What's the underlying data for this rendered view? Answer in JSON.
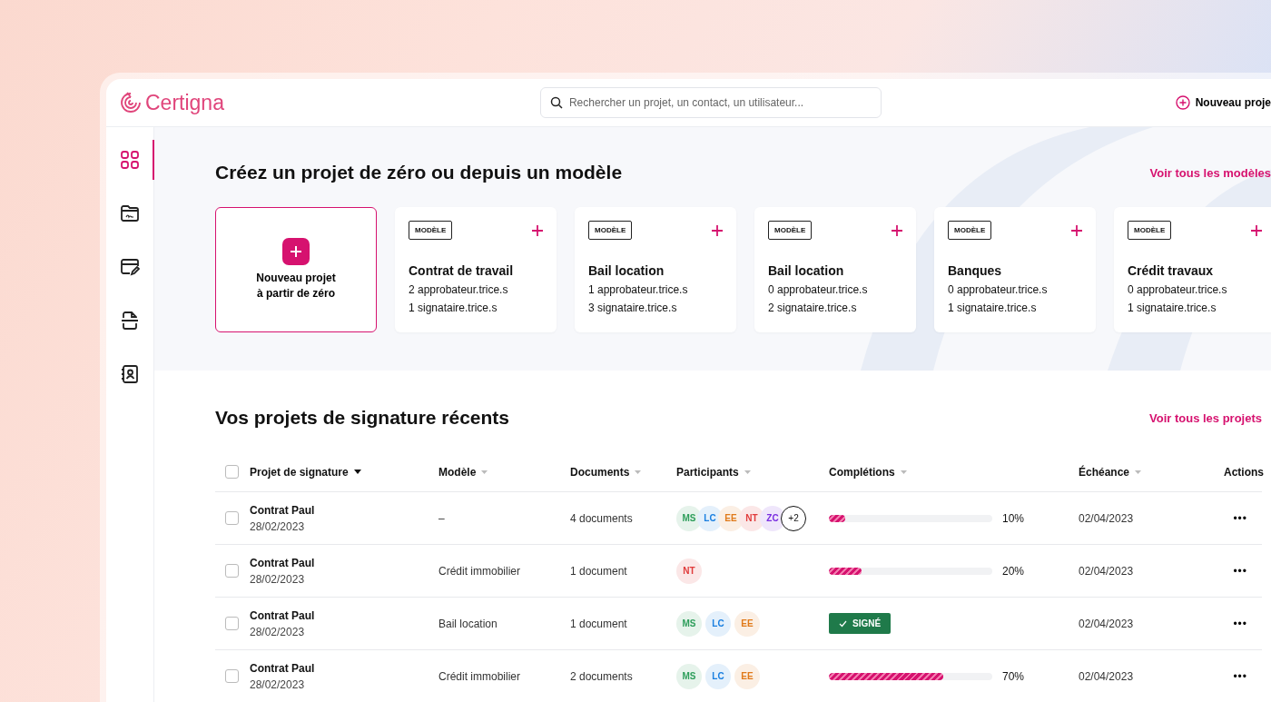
{
  "header": {
    "logo": "Certigna",
    "search": {
      "placeholder": "Rechercher un projet, un contact, un utilisateur..."
    },
    "new_project_button": "Nouveau proje"
  },
  "sidebar": {
    "items": [
      {
        "kind": "grid",
        "selected": true
      },
      {
        "kind": "folder",
        "selected": false
      },
      {
        "kind": "card",
        "selected": false
      },
      {
        "kind": "scan",
        "selected": false
      },
      {
        "kind": "contact",
        "selected": false
      }
    ]
  },
  "templates": {
    "title": "Créez un projet de zéro ou depuis un modèle",
    "link": "Voir tous les modèles",
    "new_card": {
      "label_1": "Nouveau projet",
      "label_2": "à partir de zéro"
    },
    "cards": [
      {
        "badge": "MODÈLE",
        "title": "Contrat de travail",
        "line_1": "2 approbateur.trice.s",
        "line_2": "1  signataire.trice.s"
      },
      {
        "badge": "MODÈLE",
        "title": "Bail location",
        "line_1": "1  approbateur.trice.s",
        "line_2": "3 signataire.trice.s"
      },
      {
        "badge": "MODÈLE",
        "title": "Bail location",
        "line_1": "0 approbateur.trice.s",
        "line_2": "2 signataire.trice.s"
      },
      {
        "badge": "MODÈLE",
        "title": "Banques",
        "line_1": "0 approbateur.trice.s",
        "line_2": "1  signataire.trice.s"
      },
      {
        "badge": "MODÈLE",
        "title": "Crédit travaux",
        "line_1": "0 approbateur.trice.s",
        "line_2": "1  signataire.trice.s"
      }
    ]
  },
  "recent": {
    "title": "Vos projets de signature récents",
    "link": "Voir tous les projets",
    "table": {
      "select_all_checked": false,
      "columns": [
        {
          "label": "Projet de signature",
          "sorted": true
        },
        {
          "label": "Modèle",
          "sorted": false
        },
        {
          "label": "Documents",
          "sorted": false
        },
        {
          "label": "Participants",
          "sorted": false
        },
        {
          "label": "Complétions",
          "sorted": false
        },
        {
          "label": "Échéance",
          "sorted": false
        },
        {
          "label": "Actions"
        }
      ],
      "rows": [
        {
          "checked": false,
          "name": "Contrat Paul",
          "date": "28/02/2023",
          "model": "–",
          "documents": "4 documents",
          "participants": [
            {
              "initials": "MS",
              "color": "#2e9e5b"
            },
            {
              "initials": "LC",
              "color": "#1a7fe0"
            },
            {
              "initials": "EE",
              "color": "#e07a1a"
            },
            {
              "initials": "NT",
              "color": "#e03a3a"
            },
            {
              "initials": "ZC",
              "color": "#7a2ee0"
            }
          ],
          "more": "+2",
          "completion": {
            "kind": "progress",
            "level": 0.1,
            "reading": "10%"
          },
          "due": "02/04/2023",
          "actions": "•••"
        },
        {
          "checked": false,
          "name": "Contrat Paul",
          "date": "28/02/2023",
          "model": "Crédit immobilier",
          "documents": "1 document",
          "participants": [
            {
              "initials": "NT",
              "color": "#e03a3a"
            }
          ],
          "completion": {
            "kind": "progress",
            "level": 0.2,
            "reading": "20%"
          },
          "due": "02/04/2023",
          "actions": "•••"
        },
        {
          "checked": false,
          "name": "Contrat Paul",
          "date": "28/02/2023",
          "model": "Bail location",
          "documents": "1 document",
          "participants": [
            {
              "initials": "MS",
              "color": "#2e9e5b"
            },
            {
              "initials": "LC",
              "color": "#1a7fe0"
            },
            {
              "initials": "EE",
              "color": "#e07a1a"
            }
          ],
          "completion": {
            "kind": "signed",
            "label": "SIGNÉ"
          },
          "due": "02/04/2023",
          "actions": "•••"
        },
        {
          "checked": false,
          "name": "Contrat Paul",
          "date": "28/02/2023",
          "model": "Crédit immobilier",
          "documents": "2 documents",
          "participants": [
            {
              "initials": "MS",
              "color": "#2e9e5b"
            },
            {
              "initials": "LC",
              "color": "#1a7fe0"
            },
            {
              "initials": "EE",
              "color": "#e07a1a"
            }
          ],
          "completion": {
            "kind": "progress",
            "level": 0.7,
            "reading": "70%"
          },
          "due": "02/04/2023",
          "actions": "•••"
        }
      ]
    }
  }
}
